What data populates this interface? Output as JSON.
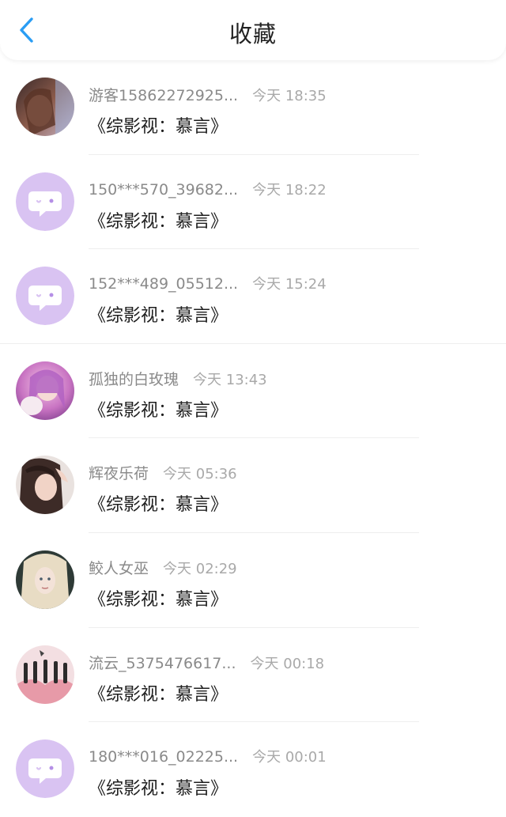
{
  "header": {
    "title": "收藏",
    "back_icon": "chevron-left-icon",
    "accent_color": "#2a9df4"
  },
  "items": [
    {
      "username": "游客15862272925...",
      "time": "今天 18:35",
      "title": "《综影视：慕言》",
      "avatar": "photo"
    },
    {
      "username": "150***570_39682...",
      "time": "今天 18:22",
      "title": "《综影视：慕言》",
      "avatar": "default-chat-icon"
    },
    {
      "username": "152***489_05512...",
      "time": "今天 15:24",
      "title": "《综影视：慕言》",
      "avatar": "default-chat-icon"
    },
    {
      "username": "孤独的白玫瑰",
      "time": "今天 13:43",
      "title": "《综影视：慕言》",
      "avatar": "photo"
    },
    {
      "username": "辉夜乐荷",
      "time": "今天 05:36",
      "title": "《综影视：慕言》",
      "avatar": "photo"
    },
    {
      "username": "鲛人女巫",
      "time": "今天 02:29",
      "title": "《综影视：慕言》",
      "avatar": "photo"
    },
    {
      "username": "流云_5375476617...",
      "time": "今天 00:18",
      "title": "《综影视：慕言》",
      "avatar": "photo"
    },
    {
      "username": "180***016_02225...",
      "time": "今天 00:01",
      "title": "《综影视：慕言》",
      "avatar": "default-chat-icon"
    }
  ],
  "colors": {
    "default_avatar_bg": "#d9c3f2",
    "default_avatar_icon": "#ffffff"
  }
}
